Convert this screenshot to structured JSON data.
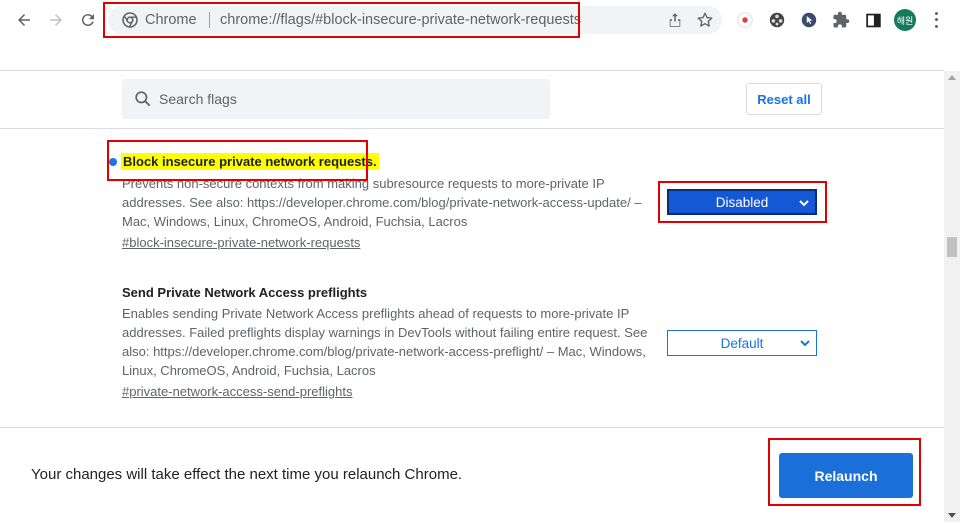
{
  "browser": {
    "omnibox": {
      "chip_label": "Chrome",
      "url": "chrome://flags/#block-insecure-private-network-requests"
    },
    "avatar_text": "해원",
    "icons": [
      "back-icon",
      "forward-icon",
      "reload-icon",
      "chrome-icon",
      "share-icon",
      "star-icon",
      "record-extension-icon",
      "film-extension-icon",
      "cursor-extension-icon",
      "puzzle-icon",
      "side-panel-icon",
      "menu-icon"
    ]
  },
  "header": {
    "search_placeholder": "Search flags",
    "reset_label": "Reset all"
  },
  "flags": [
    {
      "title": "Block insecure private network requests.",
      "description": "Prevents non-secure contexts from making subresource requests to more-private IP addresses. See also: https://developer.chrome.com/blog/private-network-access-update/ – Mac, Windows, Linux, ChromeOS, Android, Fuchsia, Lacros",
      "anchor": "#block-insecure-private-network-requests",
      "selected": "Disabled",
      "modified": true
    },
    {
      "title": "Send Private Network Access preflights",
      "description": "Enables sending Private Network Access preflights ahead of requests to more-private IP addresses. Failed preflights display warnings in DevTools without failing entire request. See also: https://developer.chrome.com/blog/private-network-access-preflight/ – Mac, Windows, Linux, ChromeOS, Android, Fuchsia, Lacros",
      "anchor": "#private-network-access-send-preflights",
      "selected": "Default",
      "modified": false
    }
  ],
  "footer": {
    "message": "Your changes will take effect the next time you relaunch Chrome.",
    "relaunch_label": "Relaunch"
  },
  "colors": {
    "accent": "#1a73e8",
    "annotation": "#e00000",
    "highlight": "#ffff00"
  }
}
